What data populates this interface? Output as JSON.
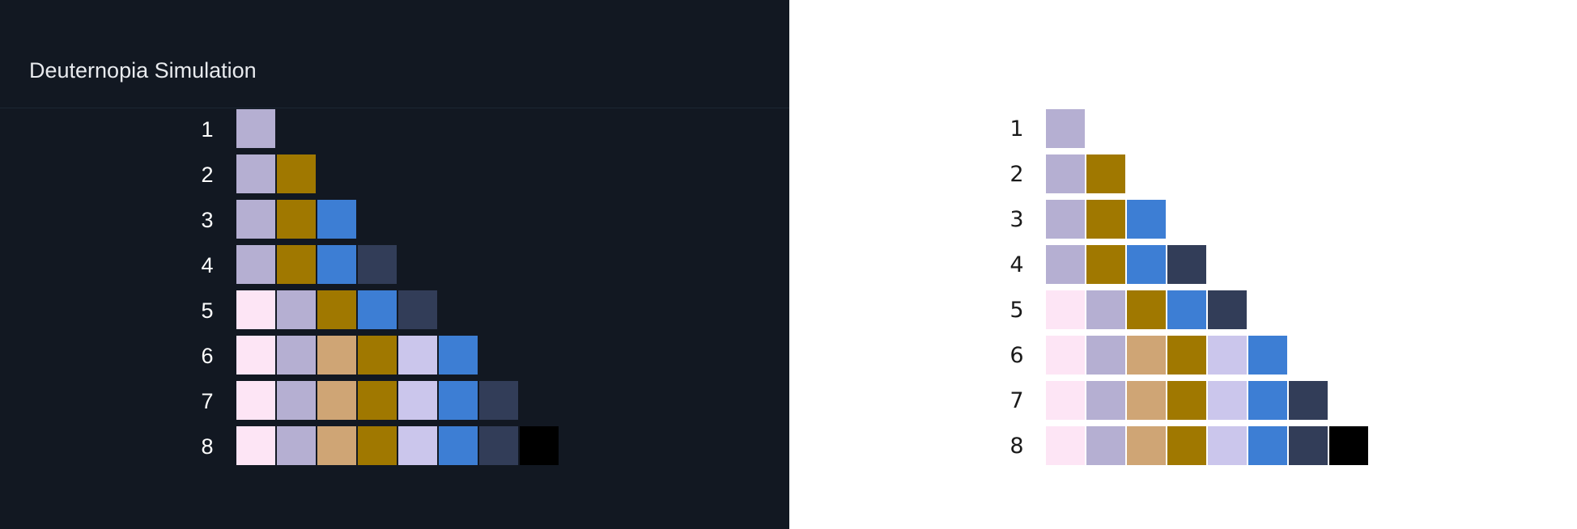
{
  "title": "Deuternopia Simulation",
  "palette": [
    {
      "row": "1",
      "colors": [
        "#b5afd2"
      ]
    },
    {
      "row": "2",
      "colors": [
        "#b5afd2",
        "#a07800"
      ]
    },
    {
      "row": "3",
      "colors": [
        "#b5afd2",
        "#a07800",
        "#3d7ed4"
      ]
    },
    {
      "row": "4",
      "colors": [
        "#b5afd2",
        "#a07800",
        "#3d7ed4",
        "#323d58"
      ]
    },
    {
      "row": "5",
      "colors": [
        "#fde5f5",
        "#b5afd2",
        "#a07800",
        "#3d7ed4",
        "#323d58"
      ]
    },
    {
      "row": "6",
      "colors": [
        "#fde5f5",
        "#b5afd2",
        "#cfa575",
        "#a07800",
        "#cbc6ec",
        "#3d7ed4"
      ]
    },
    {
      "row": "7",
      "colors": [
        "#fde5f5",
        "#b5afd2",
        "#cfa575",
        "#a07800",
        "#cbc6ec",
        "#3d7ed4",
        "#323d58"
      ]
    },
    {
      "row": "8",
      "colors": [
        "#fde5f5",
        "#b5afd2",
        "#cfa575",
        "#a07800",
        "#cbc6ec",
        "#3d7ed4",
        "#323d58",
        "#000000"
      ]
    }
  ],
  "colors": {
    "dark_background": "#121822",
    "light_background": "#ffffff"
  }
}
